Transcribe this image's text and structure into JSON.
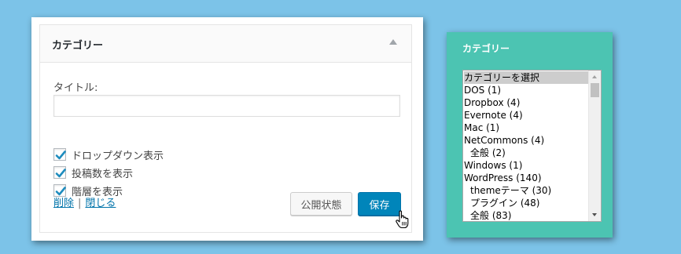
{
  "widget": {
    "title": "カテゴリー",
    "title_label": "タイトル:",
    "title_value": "",
    "options": [
      {
        "label": "ドロップダウン表示",
        "checked": true
      },
      {
        "label": "投稿数を表示",
        "checked": true
      },
      {
        "label": "階層を表示",
        "checked": true
      }
    ],
    "delete_link": "削除",
    "separator": "|",
    "close_link": "閉じる",
    "public_status_button": "公開状態",
    "save_button": "保存"
  },
  "preview": {
    "title": "カテゴリー",
    "items": [
      {
        "label": "カテゴリーを選択",
        "selected": true
      },
      {
        "label": "DOS (1)"
      },
      {
        "label": "Dropbox (4)"
      },
      {
        "label": "Evernote (4)"
      },
      {
        "label": "Mac (1)"
      },
      {
        "label": "NetCommons (4)"
      },
      {
        "label": "全般 (2)",
        "indent": 1
      },
      {
        "label": "Windows (1)"
      },
      {
        "label": "WordPress (140)"
      },
      {
        "label": "themeテーマ (30)",
        "indent": 1
      },
      {
        "label": "プラグイン (48)",
        "indent": 1
      },
      {
        "label": "全般 (83)",
        "indent": 1
      }
    ]
  },
  "colors": {
    "background": "#7cc3e8",
    "primary_button": "#0085ba",
    "preview_panel": "#4cc4b2",
    "checkmark": "#1e8cbe"
  }
}
